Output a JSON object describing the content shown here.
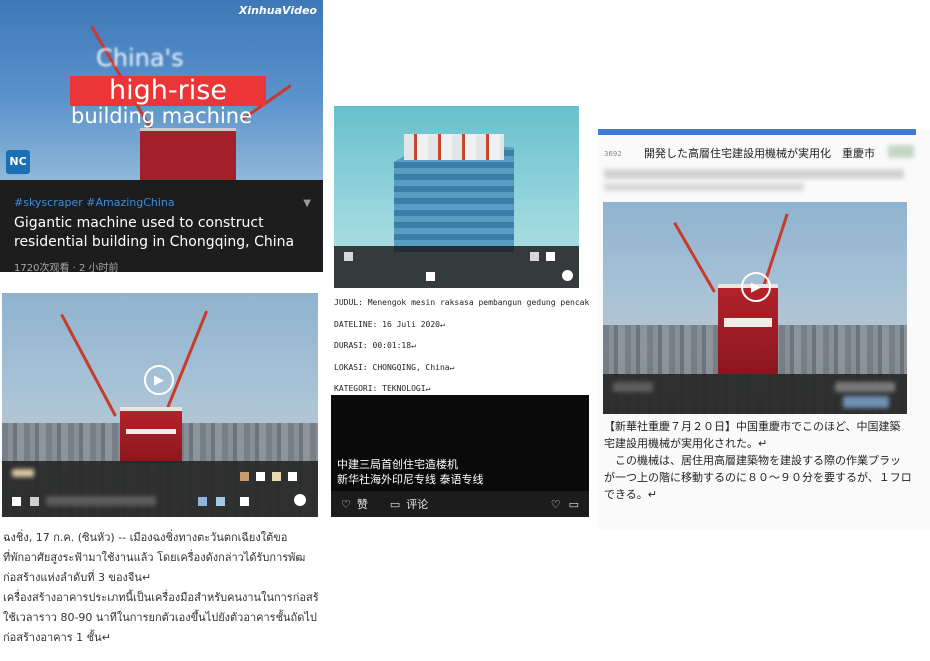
{
  "panel1": {
    "brand": "XinhuaVideo",
    "headline_line1": "China's",
    "headline_line2": "high-rise",
    "headline_line3": "building machine",
    "logo_text": "NC",
    "hashtags": "#skyscraper #AmazingChina",
    "title": "Gigantic machine used to construct residential building in Chongqing, China",
    "meta": "1720次观看 · 2 小时前"
  },
  "thai": {
    "line1": "ฉงชิ่ง, 17 ก.ค. (ซินหัว) -- เมืองฉงชิ่งทางตะวันตกเฉียงใต้ขอ",
    "line2": "ที่พักอาศัยสูงระฟ้ามาใช้งานแล้ว โดยเครื่องดังกล่าวได้รับการพัฒ",
    "line3": "ก่อสร้างแห่งลำดับที่ 3 ของจีน↵",
    "line4": "เครื่องสร้างอาคารประเภทนี้เป็นเครื่องมือสำหรับคนงานในการก่อสร้",
    "line5": "ใช้เวลาราว 80-90 นาทีในการยกตัวเองขึ้นไปยังตัวอาคารชั้นถัดไป",
    "line6": "ก่อสร้างอาคาร 1 ชั้น↵"
  },
  "panel3": {
    "judul": "JUDUL: Menengok mesin raksasa pembangun gedung pencak",
    "dateline": "DATELINE: 16 Juli 2020↵",
    "durasi": "DURASI: 00:01:18↵",
    "lokasi": "LOKASI: CHONGQING, China↵",
    "kategori": "KATEGORI: TEKNOLOGI↵",
    "caption_line1": "中建三局首创住宅造楼机",
    "caption_line2": "新华社海外印尼专线 泰语专线",
    "like_label": "赞",
    "comment_label": "评论"
  },
  "panel4": {
    "number": "3692",
    "headline": "開発した高層住宅建設用機械が実用化　重慶市",
    "jp_line1": "【新華社重慶７月２０日】中国重慶市でこのほど、中国建築",
    "jp_line2": "宅建設用機械が実用化された。↵",
    "jp_line3": "　この機械は、居住用高層建築物を建設する際の作業プラッ",
    "jp_line4": "が一つ上の階に移動するのに８０～９０分を要するが、１フロ",
    "jp_line5": "できる。↵"
  },
  "colors": {
    "accent_red": "#ea3636",
    "hashtag_blue": "#3a8ddf",
    "top_rule_blue": "#3e7bd6"
  }
}
